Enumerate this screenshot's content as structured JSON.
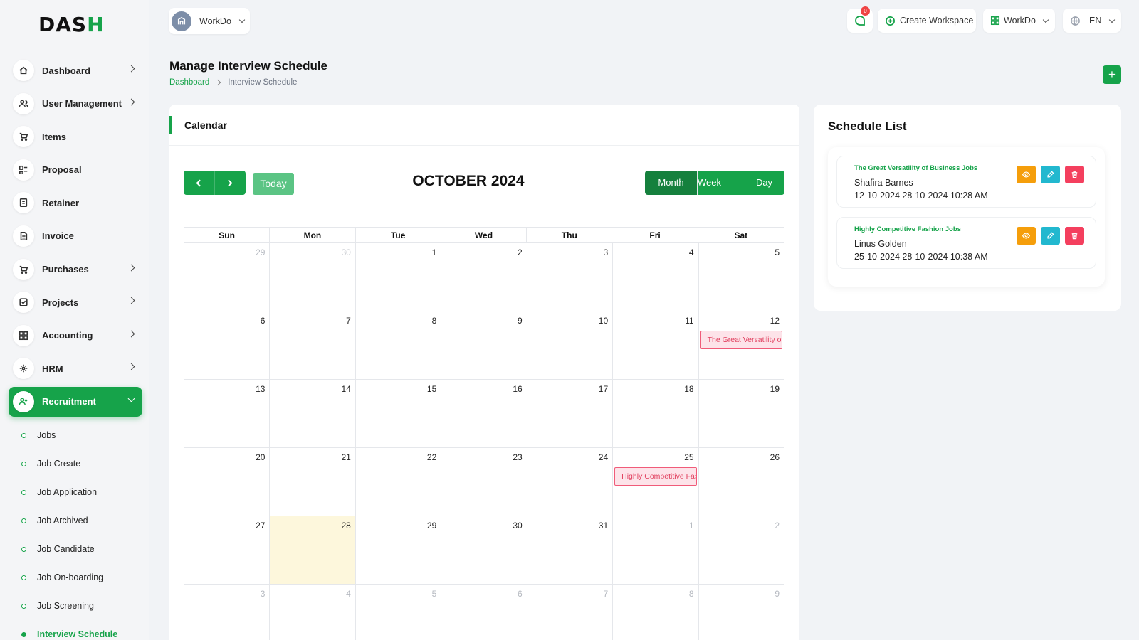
{
  "brand": {
    "logo_text": "DASH",
    "accent": "#16a34a"
  },
  "topbar": {
    "workspace_name": "WorkDo",
    "chat_badge": "0",
    "create_workspace": "Create Workspace",
    "workspace_menu": "WorkDo",
    "language": "EN"
  },
  "sidebar": {
    "items": [
      {
        "label": "Dashboard",
        "icon": "home-icon",
        "has_chevron": true
      },
      {
        "label": "User Management",
        "icon": "users-icon",
        "has_chevron": true
      },
      {
        "label": "Items",
        "icon": "cart-icon",
        "has_chevron": false
      },
      {
        "label": "Proposal",
        "icon": "proposal-icon",
        "has_chevron": false
      },
      {
        "label": "Retainer",
        "icon": "retainer-icon",
        "has_chevron": false
      },
      {
        "label": "Invoice",
        "icon": "invoice-icon",
        "has_chevron": false
      },
      {
        "label": "Purchases",
        "icon": "cart-icon",
        "has_chevron": true
      },
      {
        "label": "Projects",
        "icon": "check-square-icon",
        "has_chevron": true
      },
      {
        "label": "Accounting",
        "icon": "grid-icon",
        "has_chevron": true
      },
      {
        "label": "HRM",
        "icon": "hrm-icon",
        "has_chevron": true
      },
      {
        "label": "Recruitment",
        "icon": "user-plus-icon",
        "has_chevron": true,
        "active": true
      }
    ],
    "subitems": [
      {
        "label": "Jobs"
      },
      {
        "label": "Job Create"
      },
      {
        "label": "Job Application"
      },
      {
        "label": "Job Archived"
      },
      {
        "label": "Job Candidate"
      },
      {
        "label": "Job On-boarding"
      },
      {
        "label": "Job Screening"
      },
      {
        "label": "Interview Schedule",
        "current": true
      }
    ]
  },
  "page": {
    "title": "Manage Interview Schedule",
    "breadcrumb": {
      "home": "Dashboard",
      "current": "Interview Schedule"
    },
    "add_button": "+"
  },
  "calendar": {
    "card_title": "Calendar",
    "today_label": "Today",
    "month_title": "OCTOBER 2024",
    "views": {
      "month": "Month",
      "week": "Week",
      "day": "Day"
    },
    "weekdays": [
      "Sun",
      "Mon",
      "Tue",
      "Wed",
      "Thu",
      "Fri",
      "Sat"
    ],
    "weeks": [
      [
        {
          "d": "29",
          "other": true
        },
        {
          "d": "30",
          "other": true
        },
        {
          "d": "1"
        },
        {
          "d": "2"
        },
        {
          "d": "3"
        },
        {
          "d": "4"
        },
        {
          "d": "5"
        }
      ],
      [
        {
          "d": "6"
        },
        {
          "d": "7"
        },
        {
          "d": "8"
        },
        {
          "d": "9"
        },
        {
          "d": "10"
        },
        {
          "d": "11"
        },
        {
          "d": "12",
          "event": "The Great Versatility of Business Jobs"
        }
      ],
      [
        {
          "d": "13"
        },
        {
          "d": "14"
        },
        {
          "d": "15"
        },
        {
          "d": "16"
        },
        {
          "d": "17"
        },
        {
          "d": "18"
        },
        {
          "d": "19"
        }
      ],
      [
        {
          "d": "20"
        },
        {
          "d": "21"
        },
        {
          "d": "22"
        },
        {
          "d": "23"
        },
        {
          "d": "24"
        },
        {
          "d": "25",
          "event": "Highly Competitive Fashion Jobs"
        },
        {
          "d": "26"
        }
      ],
      [
        {
          "d": "27"
        },
        {
          "d": "28",
          "today": true
        },
        {
          "d": "29"
        },
        {
          "d": "30"
        },
        {
          "d": "31"
        },
        {
          "d": "1",
          "other": true
        },
        {
          "d": "2",
          "other": true
        }
      ],
      [
        {
          "d": "3",
          "other": true
        },
        {
          "d": "4",
          "other": true
        },
        {
          "d": "5",
          "other": true
        },
        {
          "d": "6",
          "other": true
        },
        {
          "d": "7",
          "other": true
        },
        {
          "d": "8",
          "other": true
        },
        {
          "d": "9",
          "other": true
        }
      ]
    ]
  },
  "schedule": {
    "title": "Schedule List",
    "items": [
      {
        "job": "The Great Versatility of Business Jobs",
        "name": "Shafira Barnes",
        "dates": "12-10-2024 28-10-2024 10:28 AM"
      },
      {
        "job": "Highly Competitive Fashion Jobs",
        "name": "Linus Golden",
        "dates": "25-10-2024 28-10-2024 10:38 AM"
      }
    ]
  }
}
